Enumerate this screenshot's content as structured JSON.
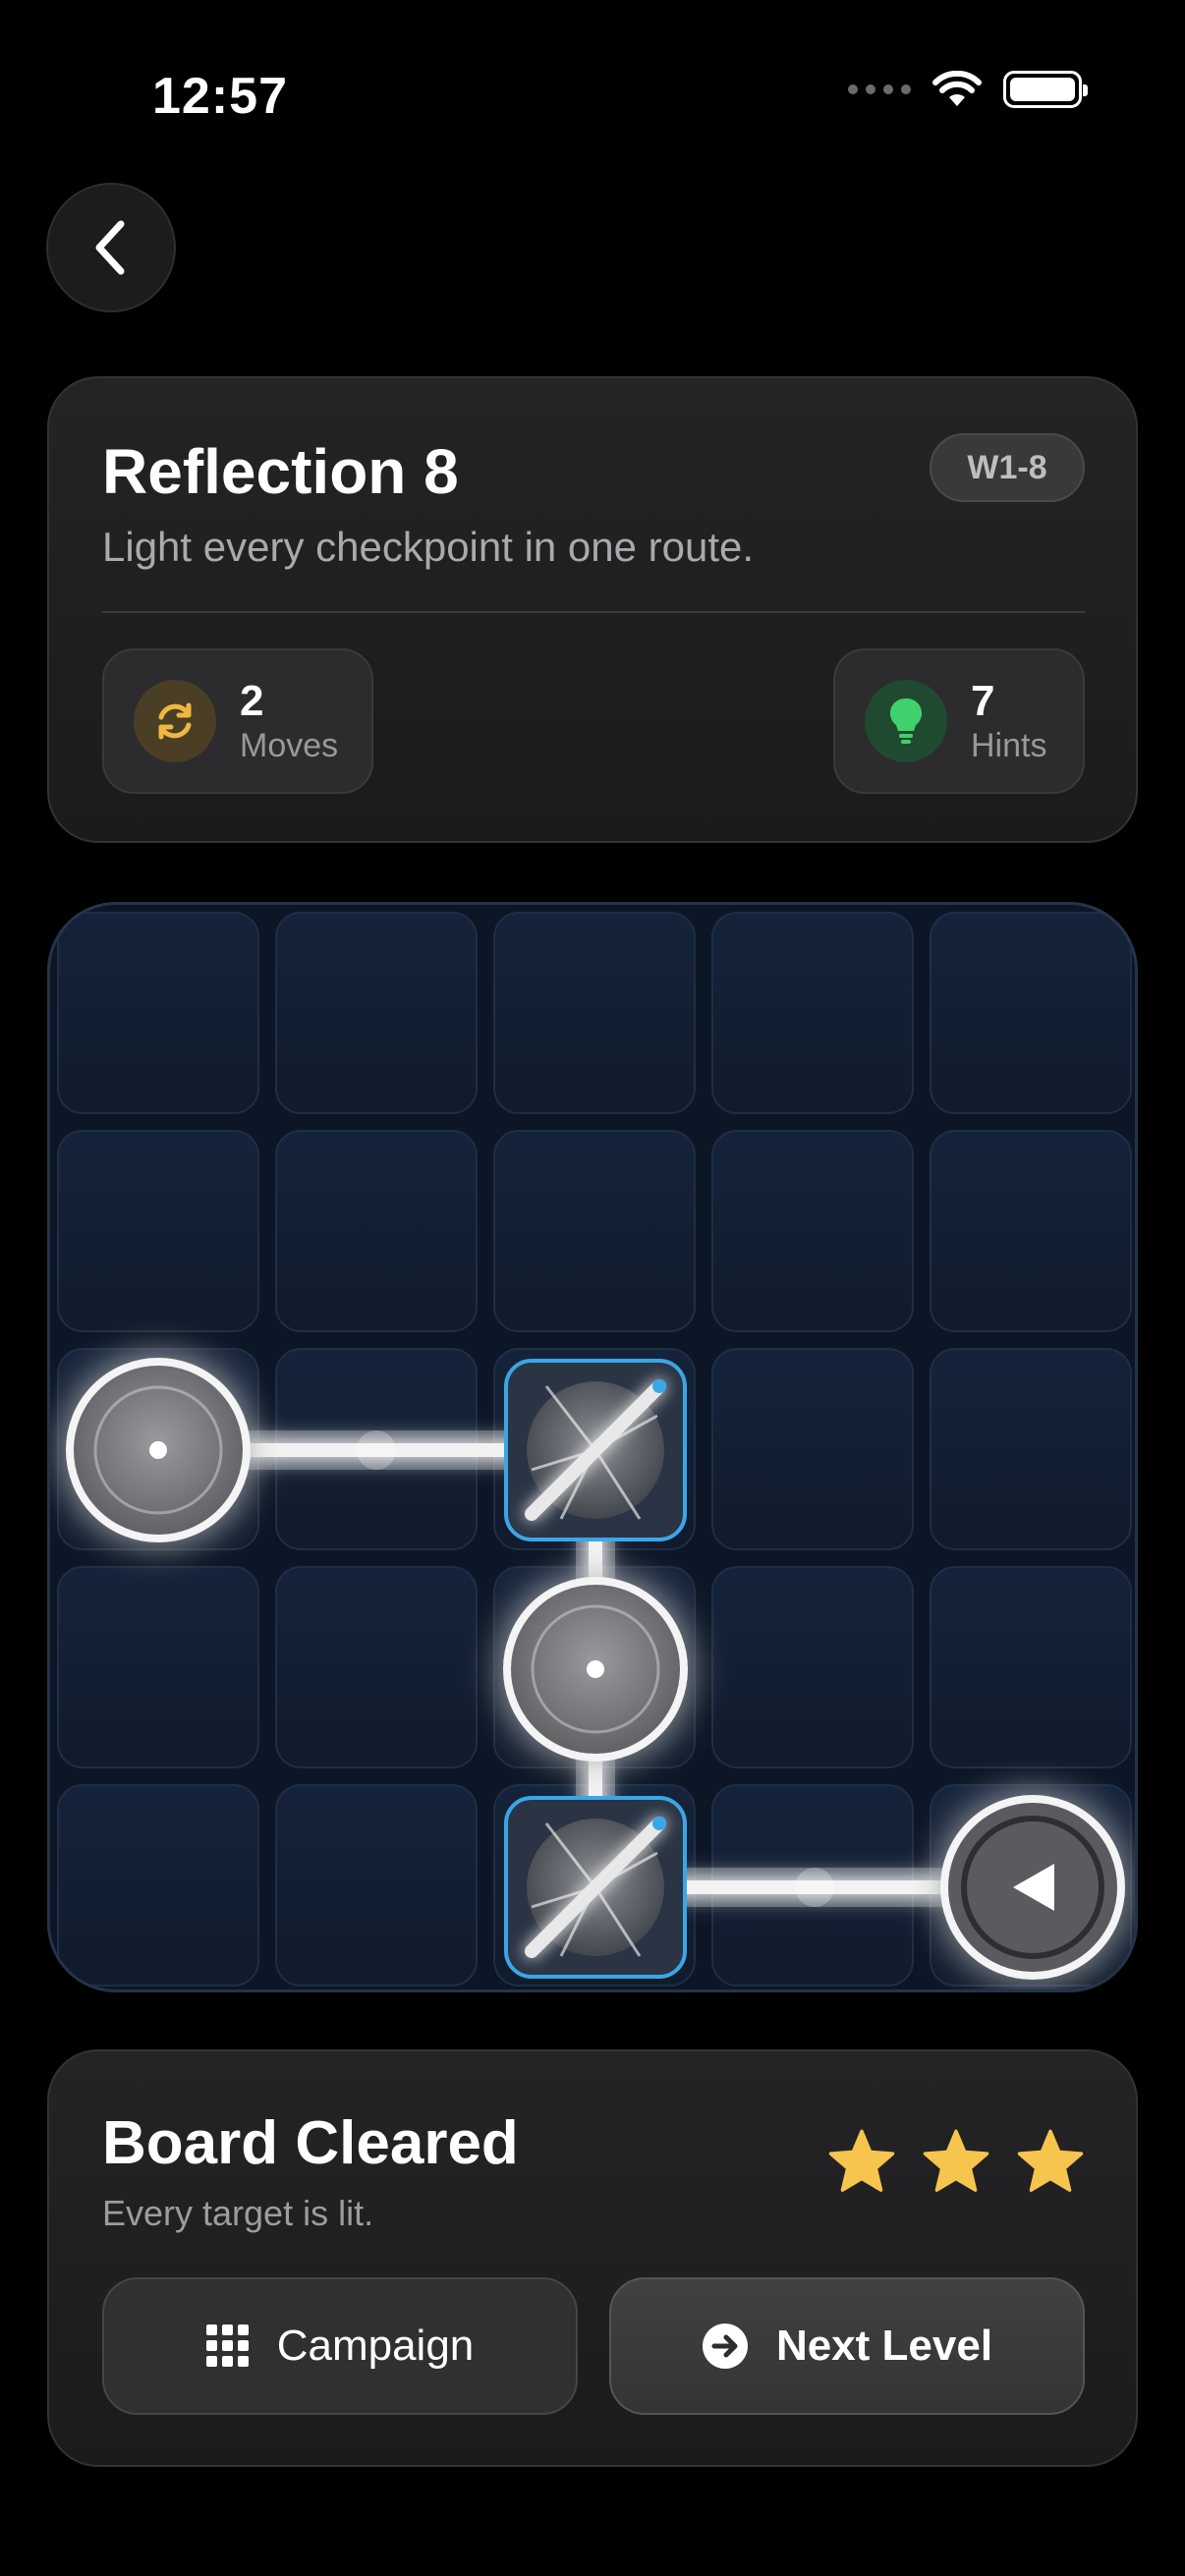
{
  "status_bar": {
    "time": "12:57"
  },
  "level": {
    "title": "Reflection 8",
    "badge": "W1-8",
    "subtitle": "Light every checkpoint in one route.",
    "moves": {
      "value": "2",
      "label": "Moves"
    },
    "hints": {
      "value": "7",
      "label": "Hints"
    }
  },
  "board": {
    "rows": 5,
    "cols": 5,
    "pieces": [
      {
        "type": "target",
        "row": 3,
        "col": 1,
        "lit": true
      },
      {
        "type": "mirror",
        "row": 3,
        "col": 3,
        "orientation": "slash"
      },
      {
        "type": "target",
        "row": 4,
        "col": 3,
        "lit": true
      },
      {
        "type": "mirror",
        "row": 5,
        "col": 3,
        "orientation": "slash"
      },
      {
        "type": "emitter",
        "row": 5,
        "col": 5,
        "direction": "left"
      }
    ]
  },
  "result": {
    "title": "Board Cleared",
    "subtitle": "Every target is lit.",
    "stars": 3,
    "campaign_label": "Campaign",
    "next_label": "Next Level"
  },
  "colors": {
    "star": "#f6c54e",
    "accent_blue": "#39a7e6",
    "moves_icon": "#f0b640",
    "hints_icon": "#41d06e"
  }
}
